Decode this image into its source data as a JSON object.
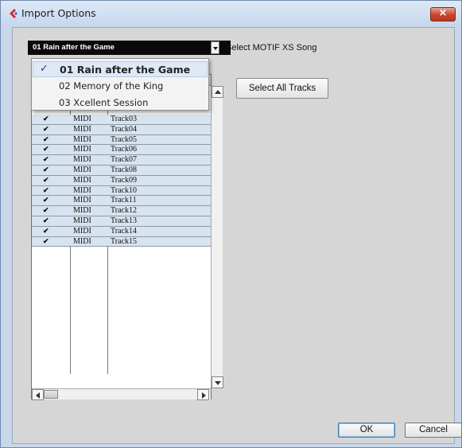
{
  "window": {
    "title": "Import Options",
    "close_label": "×"
  },
  "song_select": {
    "value": "01 Rain after the Game",
    "label": "Select MOTIF XS Song"
  },
  "dropdown": {
    "items": [
      {
        "label": "01 Rain after the Game",
        "selected": true,
        "check": "✓"
      },
      {
        "label": "02 Memory of the King",
        "selected": false
      },
      {
        "label": "03 Xcellent Session",
        "selected": false
      }
    ]
  },
  "select_all_label": "Select All Tracks",
  "tracks": [
    {
      "check": "✔",
      "type": "MIDI",
      "name": "Track03"
    },
    {
      "check": "✔",
      "type": "MIDI",
      "name": "Track04"
    },
    {
      "check": "✔",
      "type": "MIDI",
      "name": "Track05"
    },
    {
      "check": "✔",
      "type": "MIDI",
      "name": "Track06"
    },
    {
      "check": "✔",
      "type": "MIDI",
      "name": "Track07"
    },
    {
      "check": "✔",
      "type": "MIDI",
      "name": "Track08"
    },
    {
      "check": "✔",
      "type": "MIDI",
      "name": "Track09"
    },
    {
      "check": "✔",
      "type": "MIDI",
      "name": "Track10"
    },
    {
      "check": "✔",
      "type": "MIDI",
      "name": "Track11"
    },
    {
      "check": "✔",
      "type": "MIDI",
      "name": "Track12"
    },
    {
      "check": "✔",
      "type": "MIDI",
      "name": "Track13"
    },
    {
      "check": "✔",
      "type": "MIDI",
      "name": "Track14"
    },
    {
      "check": "✔",
      "type": "MIDI",
      "name": "Track15"
    }
  ],
  "buttons": {
    "ok": "OK",
    "cancel": "Cancel"
  },
  "colors": {
    "app_icon": "#d6283a",
    "row_bg": "#d7e3ee",
    "selected_menu": "#dfe9f6"
  }
}
